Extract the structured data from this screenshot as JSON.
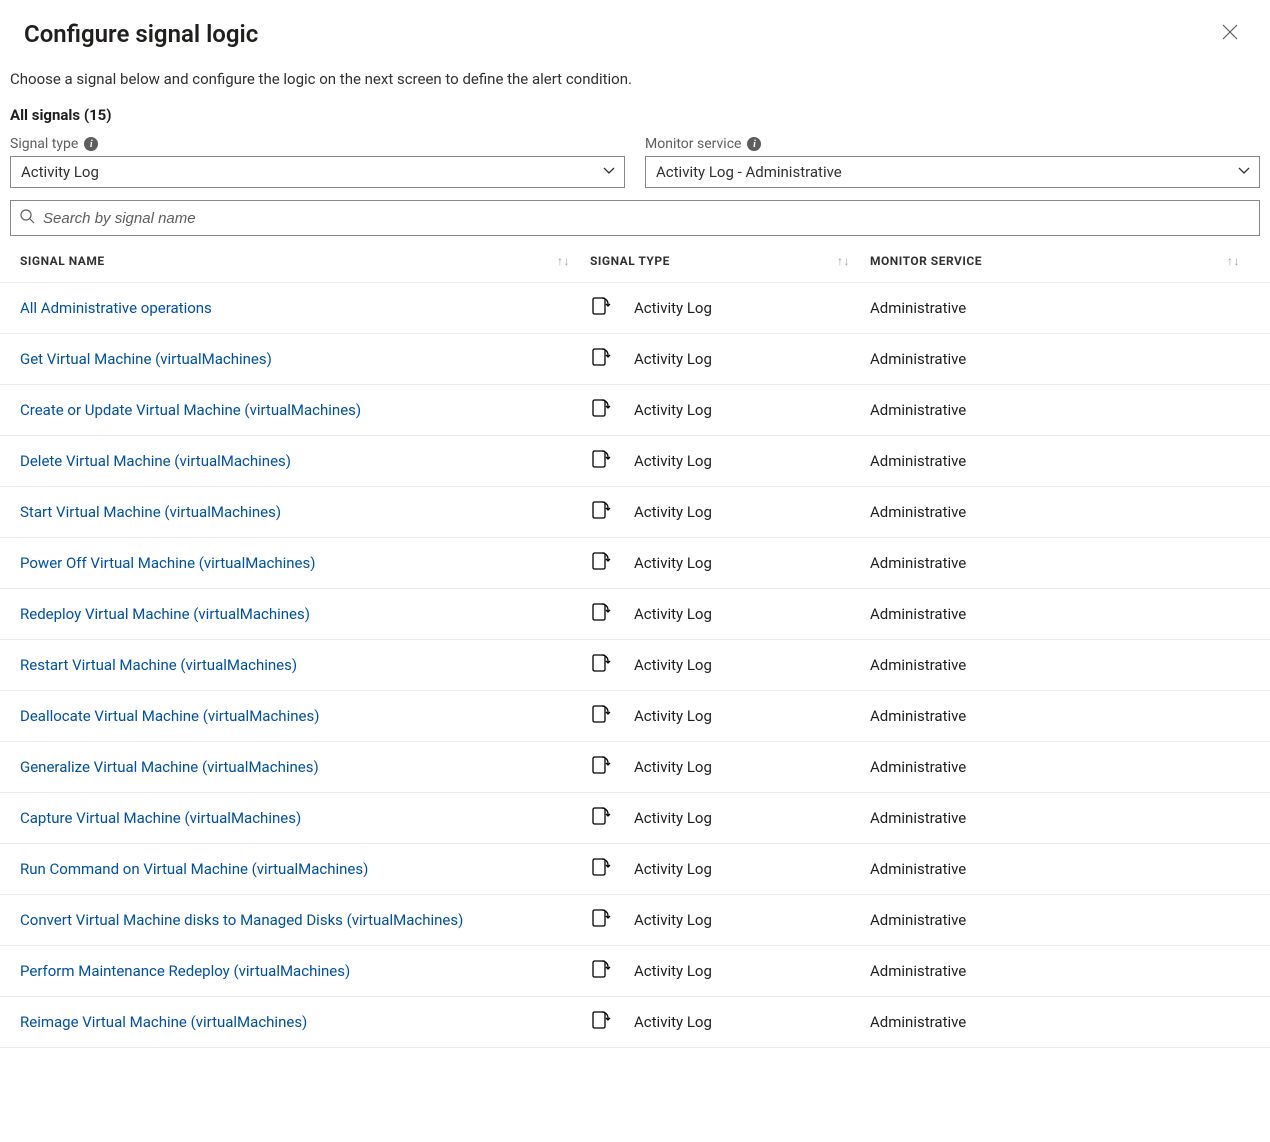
{
  "header": {
    "title": "Configure signal logic"
  },
  "description": "Choose a signal below and configure the logic on the next screen to define the alert condition.",
  "subheader": "All signals (15)",
  "filters": {
    "signal_type": {
      "label": "Signal type",
      "value": "Activity Log"
    },
    "monitor_service": {
      "label": "Monitor service",
      "value": "Activity Log - Administrative"
    }
  },
  "search": {
    "placeholder": "Search by signal name"
  },
  "columns": {
    "name": "Signal name",
    "type": "Signal type",
    "monitor": "Monitor service"
  },
  "rows": [
    {
      "name": "All Administrative operations",
      "type": "Activity Log",
      "monitor": "Administrative"
    },
    {
      "name": "Get Virtual Machine (virtualMachines)",
      "type": "Activity Log",
      "monitor": "Administrative"
    },
    {
      "name": "Create or Update Virtual Machine (virtualMachines)",
      "type": "Activity Log",
      "monitor": "Administrative"
    },
    {
      "name": "Delete Virtual Machine (virtualMachines)",
      "type": "Activity Log",
      "monitor": "Administrative"
    },
    {
      "name": "Start Virtual Machine (virtualMachines)",
      "type": "Activity Log",
      "monitor": "Administrative"
    },
    {
      "name": "Power Off Virtual Machine (virtualMachines)",
      "type": "Activity Log",
      "monitor": "Administrative"
    },
    {
      "name": "Redeploy Virtual Machine (virtualMachines)",
      "type": "Activity Log",
      "monitor": "Administrative"
    },
    {
      "name": "Restart Virtual Machine (virtualMachines)",
      "type": "Activity Log",
      "monitor": "Administrative"
    },
    {
      "name": "Deallocate Virtual Machine (virtualMachines)",
      "type": "Activity Log",
      "monitor": "Administrative"
    },
    {
      "name": "Generalize Virtual Machine (virtualMachines)",
      "type": "Activity Log",
      "monitor": "Administrative"
    },
    {
      "name": "Capture Virtual Machine (virtualMachines)",
      "type": "Activity Log",
      "monitor": "Administrative"
    },
    {
      "name": "Run Command on Virtual Machine (virtualMachines)",
      "type": "Activity Log",
      "monitor": "Administrative"
    },
    {
      "name": "Convert Virtual Machine disks to Managed Disks (virtualMachines)",
      "type": "Activity Log",
      "monitor": "Administrative"
    },
    {
      "name": "Perform Maintenance Redeploy (virtualMachines)",
      "type": "Activity Log",
      "monitor": "Administrative"
    },
    {
      "name": "Reimage Virtual Machine (virtualMachines)",
      "type": "Activity Log",
      "monitor": "Administrative"
    }
  ]
}
